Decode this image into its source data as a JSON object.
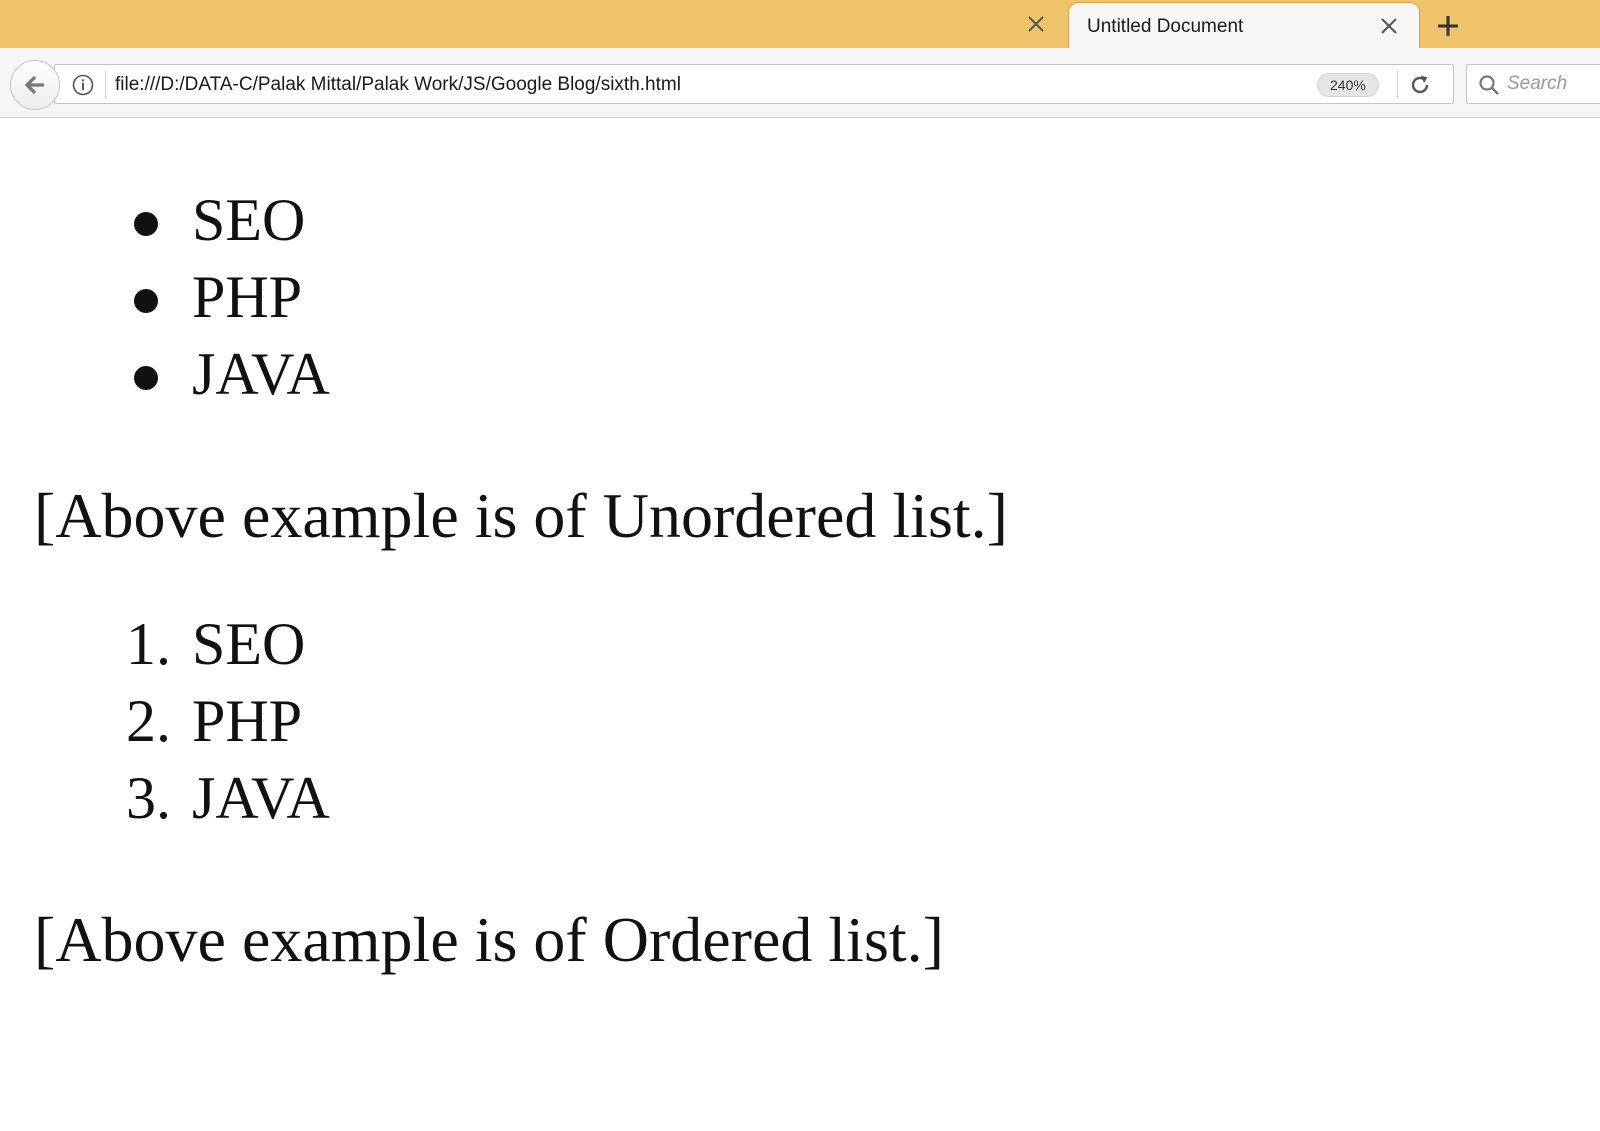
{
  "browser": {
    "tab": {
      "title": "Untitled Document"
    },
    "toolbar": {
      "url": "file:///D:/DATA-C/Palak Mittal/Palak Work/JS/Google Blog/sixth.html",
      "zoom": "240%",
      "search_placeholder": "Search"
    },
    "colors": {
      "tabstrip": "#eec36a",
      "toolbar": "#f6f6f6"
    }
  },
  "page": {
    "unordered_list": [
      "SEO",
      "PHP",
      "JAVA"
    ],
    "unordered_caption": "[Above example is of Unordered list.]",
    "ordered_list": [
      {
        "marker": "1.",
        "text": "SEO"
      },
      {
        "marker": "2.",
        "text": "PHP"
      },
      {
        "marker": "3.",
        "text": "JAVA"
      }
    ],
    "ordered_caption": "[Above example is of Ordered list.]"
  }
}
